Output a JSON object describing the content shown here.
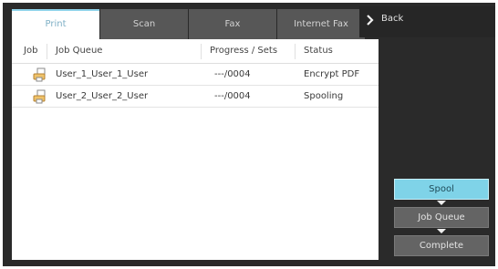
{
  "tabs": [
    {
      "label": "Print",
      "active": true
    },
    {
      "label": "Scan",
      "active": false
    },
    {
      "label": "Fax",
      "active": false
    },
    {
      "label": "Internet Fax",
      "active": false
    }
  ],
  "back_button": {
    "label": "Back",
    "icon": "chevron-right-icon"
  },
  "table": {
    "headers": [
      "Job",
      "Job Queue",
      "Progress / Sets",
      "Status"
    ],
    "rows": [
      {
        "icon": "print-job-icon",
        "queue": "User_1_User_1_User",
        "progress": "---/0004",
        "status": "Encrypt PDF"
      },
      {
        "icon": "print-job-icon",
        "queue": "User_2_User_2_User",
        "progress": "---/0004",
        "status": "Spooling"
      }
    ]
  },
  "queue_buttons": [
    {
      "label": "Spool",
      "active": true
    },
    {
      "label": "Job Queue",
      "active": false
    },
    {
      "label": "Complete",
      "active": false
    }
  ],
  "colors": {
    "accent": "#7fd3e8",
    "active_tab_text": "#7fb0c6",
    "background": "#2a2a2a",
    "inactive_tab": "#575757"
  }
}
